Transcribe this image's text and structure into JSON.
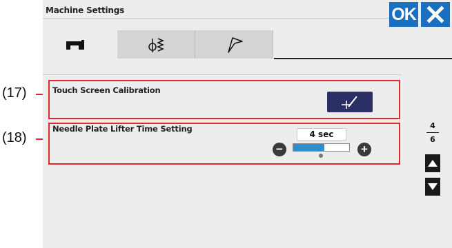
{
  "window": {
    "title": "Machine Settings"
  },
  "header": {
    "ok_label": "OK"
  },
  "tabs": [
    {
      "icon": "sewing-machine-icon",
      "active": true
    },
    {
      "icon": "needle-zigzag-icon",
      "active": false
    },
    {
      "icon": "flag-icon",
      "active": false
    }
  ],
  "settings": {
    "touch_calibration": {
      "label": "Touch Screen Calibration",
      "icon": "calibration-crosshair-icon"
    },
    "needle_plate_lifter": {
      "label": "Needle Plate Lifter Time Setting",
      "value": "4 sec",
      "level_fraction": 0.55
    }
  },
  "pagination": {
    "current": "4",
    "total": "6"
  },
  "callouts": [
    {
      "label": "(17)",
      "target": "touch-screen-calibration"
    },
    {
      "label": "(18)",
      "target": "needle-plate-lifter-time-setting"
    }
  ],
  "colors": {
    "accent_blue": "#1a6fc0",
    "calibration_button": "#2b2f66",
    "slider_fill": "#2e8fd0",
    "callout_red": "#e0262e"
  }
}
